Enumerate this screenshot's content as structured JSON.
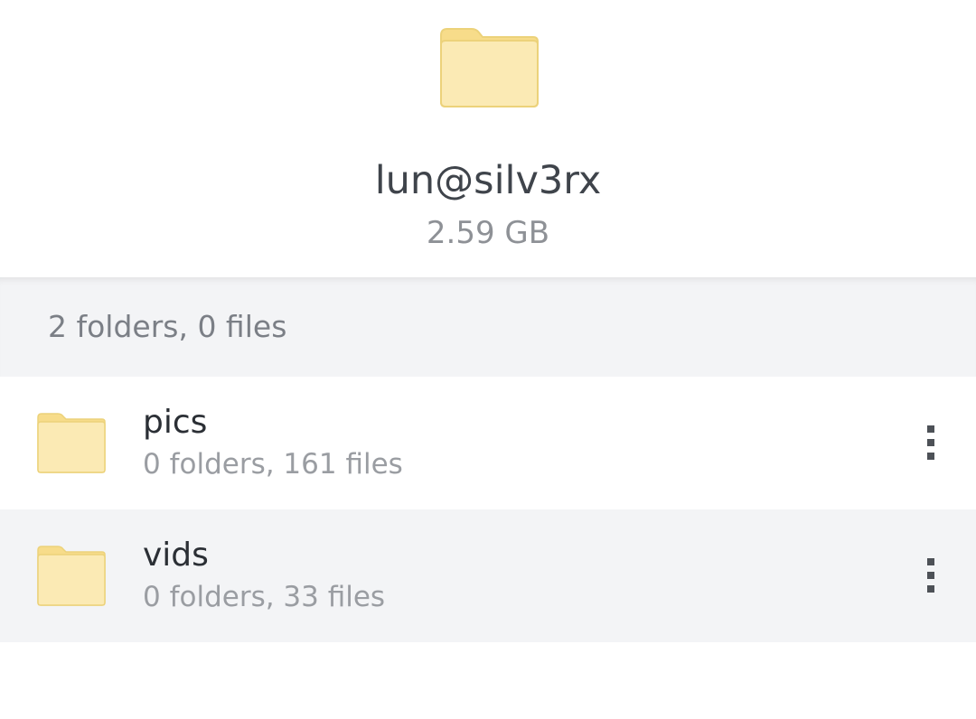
{
  "header": {
    "icon": "folder-icon",
    "title": "lun@silv3rx",
    "size": "2.59 GB"
  },
  "summary": {
    "text": "2 folders, 0 files"
  },
  "folders": [
    {
      "name": "pics",
      "meta": "0 folders, 161 files",
      "icon": "folder-icon",
      "menu_icon": "more-vertical-icon"
    },
    {
      "name": "vids",
      "meta": "0 folders, 33 files",
      "icon": "folder-icon",
      "menu_icon": "more-vertical-icon"
    }
  ],
  "colors": {
    "folder_fill": "#fbeab4",
    "folder_tab": "#f7dc8a",
    "folder_stroke": "#ecd27a",
    "row_alt_bg": "#f3f4f6"
  }
}
